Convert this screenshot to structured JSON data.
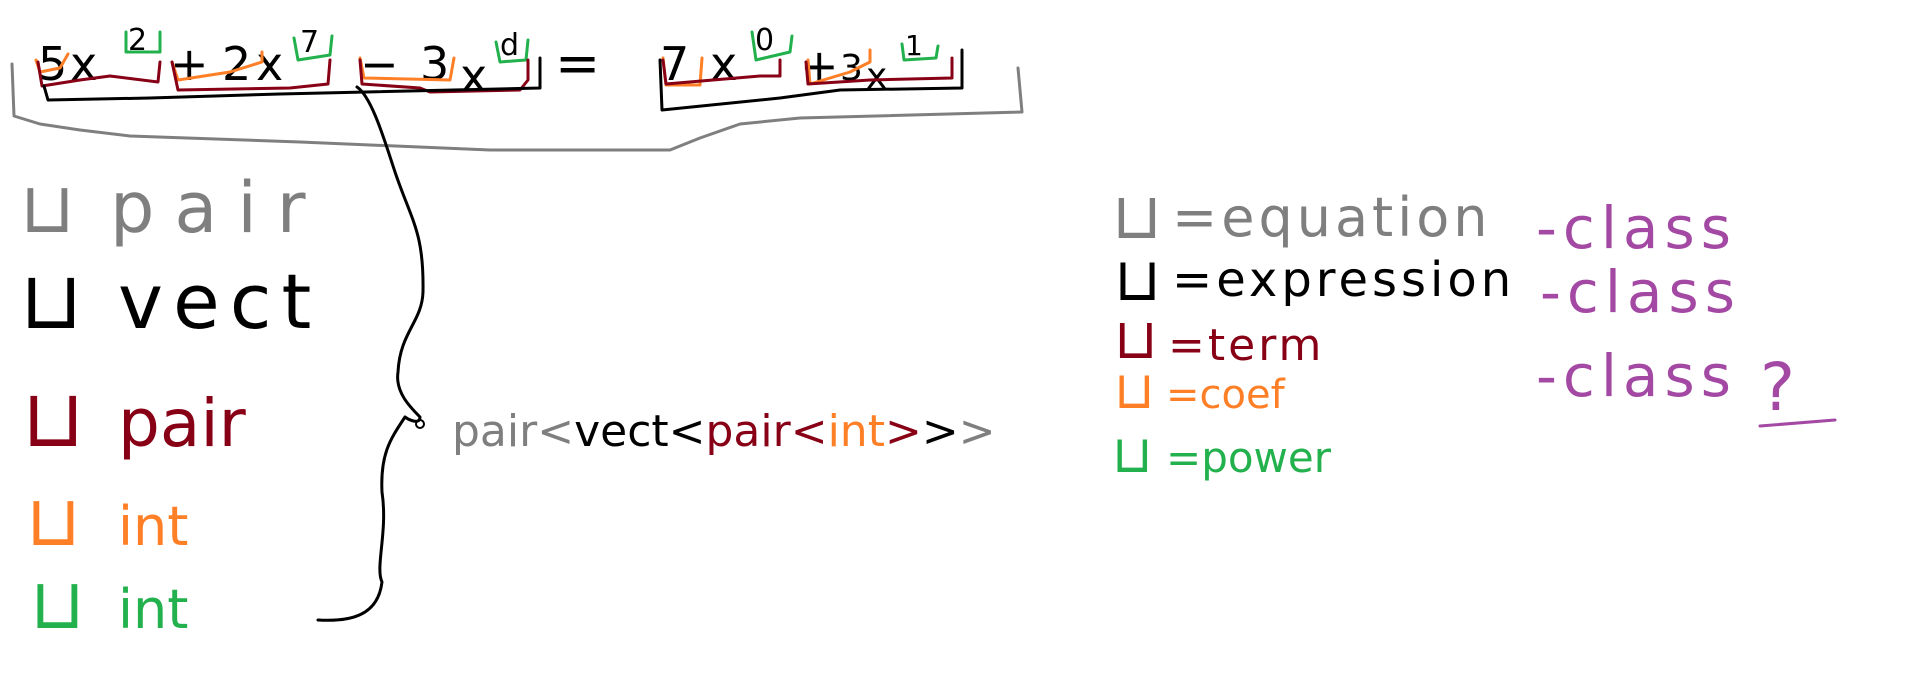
{
  "colors": {
    "equation": "#7f7f7f",
    "expression": "#000000",
    "term": "#880015",
    "coef": "#ff7f27",
    "power": "#22b14c",
    "class_note": "#a349a4"
  },
  "equation": {
    "lhs": [
      {
        "sign": "",
        "coef": "5",
        "var": "x",
        "power": "2"
      },
      {
        "sign": "+",
        "coef": "2",
        "var": "x",
        "power": "7"
      },
      {
        "sign": "−",
        "coef": "3",
        "var": "x",
        "power": "d"
      }
    ],
    "equals": "=",
    "rhs": [
      {
        "sign": "",
        "coef": "7",
        "var": "x",
        "power": "0"
      },
      {
        "sign": "+",
        "coef": "3",
        "var": "x",
        "power": "1"
      }
    ]
  },
  "type_list": [
    {
      "box": "⊔",
      "label": "pair",
      "level": "equation"
    },
    {
      "box": "⊔",
      "label": "vect",
      "level": "expression"
    },
    {
      "box": "⊔",
      "label": "pair",
      "level": "term"
    },
    {
      "box": "⊔",
      "label": "int",
      "level": "coef"
    },
    {
      "box": "⊔",
      "label": "int",
      "level": "power"
    }
  ],
  "type_expression": {
    "parts": [
      {
        "text": "pair<",
        "level": "equation"
      },
      {
        "text": "vect<",
        "level": "expression"
      },
      {
        "text": "pair<",
        "level": "term"
      },
      {
        "text": "int",
        "level": "coef"
      },
      {
        "text": ">",
        "level": "term"
      },
      {
        "text": ">",
        "level": "expression"
      },
      {
        "text": ">",
        "level": "equation"
      }
    ]
  },
  "legend": [
    {
      "box": "⊔",
      "text": "=equation",
      "level": "equation"
    },
    {
      "box": "⊔",
      "text": "=expression",
      "level": "expression"
    },
    {
      "box": "⊔",
      "text": "=term",
      "level": "term"
    },
    {
      "box": "⊔",
      "text": "=coef",
      "level": "coef"
    },
    {
      "box": "⊔",
      "text": "=power",
      "level": "power"
    }
  ],
  "class_notes": [
    "-class",
    "-class",
    "-class"
  ],
  "class_question": "?"
}
